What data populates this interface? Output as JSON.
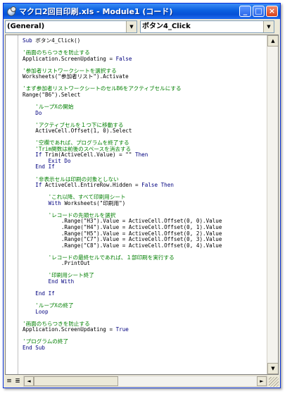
{
  "window": {
    "title": "マクロ2回目印刷.xls - Module1 (コード)",
    "buttons": {
      "minimize": "_",
      "maximize": "□",
      "close": "×"
    }
  },
  "combos": {
    "object": "(General)",
    "procedure": "ボタン4_Click"
  },
  "code_lines": [
    [
      [
        "kw",
        "Sub "
      ],
      [
        "tx",
        "ボタン4_Click()"
      ]
    ],
    [],
    [
      [
        "cm",
        "'画面のちらつきを防止する"
      ]
    ],
    [
      [
        "tx",
        "Application.ScreenUpdating = "
      ],
      [
        "kw",
        "False"
      ]
    ],
    [],
    [
      [
        "cm",
        "'参加者リストワークシートを選択する"
      ]
    ],
    [
      [
        "tx",
        "Worksheets(\"参加者リスト\").Activate"
      ]
    ],
    [],
    [
      [
        "cm",
        "'まず参加者リストワークシートのセルB6をアクティブセルにする"
      ]
    ],
    [
      [
        "tx",
        "Range(\"B6\").Select"
      ]
    ],
    [],
    [
      [
        "cm",
        "    'ループXの開始"
      ]
    ],
    [
      [
        "kw",
        "    Do"
      ]
    ],
    [],
    [
      [
        "cm",
        "    'アクティブセルを１つ下に移動する"
      ]
    ],
    [
      [
        "tx",
        "    ActiveCell.Offset(1, 0).Select"
      ]
    ],
    [],
    [
      [
        "cm",
        "    '空欄であれば、プログラムを終了する"
      ]
    ],
    [
      [
        "cm",
        "    'Trim関数は前後のスペースを消去する"
      ]
    ],
    [
      [
        "kw",
        "    If "
      ],
      [
        "tx",
        "Trim(ActiveCell.Value) = \"\" "
      ],
      [
        "kw",
        "Then"
      ]
    ],
    [
      [
        "kw",
        "        Exit Do"
      ]
    ],
    [
      [
        "kw",
        "    End If"
      ]
    ],
    [],
    [
      [
        "cm",
        "    '非表示セルは印刷の対象としない"
      ]
    ],
    [
      [
        "kw",
        "    If "
      ],
      [
        "tx",
        "ActiveCell.EntireRow.Hidden = "
      ],
      [
        "kw",
        "False Then"
      ]
    ],
    [],
    [
      [
        "cm",
        "        'これ以降、すべて印刷用シート"
      ]
    ],
    [
      [
        "kw",
        "        With "
      ],
      [
        "tx",
        "Worksheets(\"印刷用\")"
      ]
    ],
    [],
    [
      [
        "cm",
        "        'レコードの先頭セルを選択"
      ]
    ],
    [
      [
        "tx",
        "            .Range(\"H3\").Value = ActiveCell.Offset(0, 0).Value"
      ]
    ],
    [
      [
        "tx",
        "            .Range(\"H4\").Value = ActiveCell.Offset(0, 1).Value"
      ]
    ],
    [
      [
        "tx",
        "            .Range(\"H5\").Value = ActiveCell.Offset(0, 2).Value"
      ]
    ],
    [
      [
        "tx",
        "            .Range(\"C7\").Value = ActiveCell.Offset(0, 3).Value"
      ]
    ],
    [
      [
        "tx",
        "            .Range(\"C8\").Value = ActiveCell.Offset(0, 4).Value"
      ]
    ],
    [],
    [
      [
        "cm",
        "        'レコードの最終セルであれば、１部印刷を実行する"
      ]
    ],
    [
      [
        "tx",
        "            .PrintOut"
      ]
    ],
    [],
    [
      [
        "cm",
        "        '印刷用シート終了"
      ]
    ],
    [
      [
        "kw",
        "        End With"
      ]
    ],
    [],
    [
      [
        "kw",
        "    End If"
      ]
    ],
    [],
    [
      [
        "cm",
        "    'ループXの終了"
      ]
    ],
    [
      [
        "kw",
        "    Loop"
      ]
    ],
    [],
    [
      [
        "cm",
        "'画面のちらつきを防止する"
      ]
    ],
    [
      [
        "tx",
        "Application.ScreenUpdating = "
      ],
      [
        "kw",
        "True"
      ]
    ],
    [],
    [
      [
        "cm",
        "'プログラムの終了"
      ]
    ],
    [
      [
        "kw",
        "End Sub"
      ]
    ]
  ],
  "scroll": {
    "up": "▲",
    "down": "▼",
    "left": "◄",
    "right": "►"
  },
  "view_buttons": {
    "procedure_view": "≡",
    "module_view": "≣"
  },
  "colors": {
    "keyword": "#00007f",
    "comment": "#007f00",
    "text": "#000000",
    "titlebar": "#0a5fe0"
  }
}
